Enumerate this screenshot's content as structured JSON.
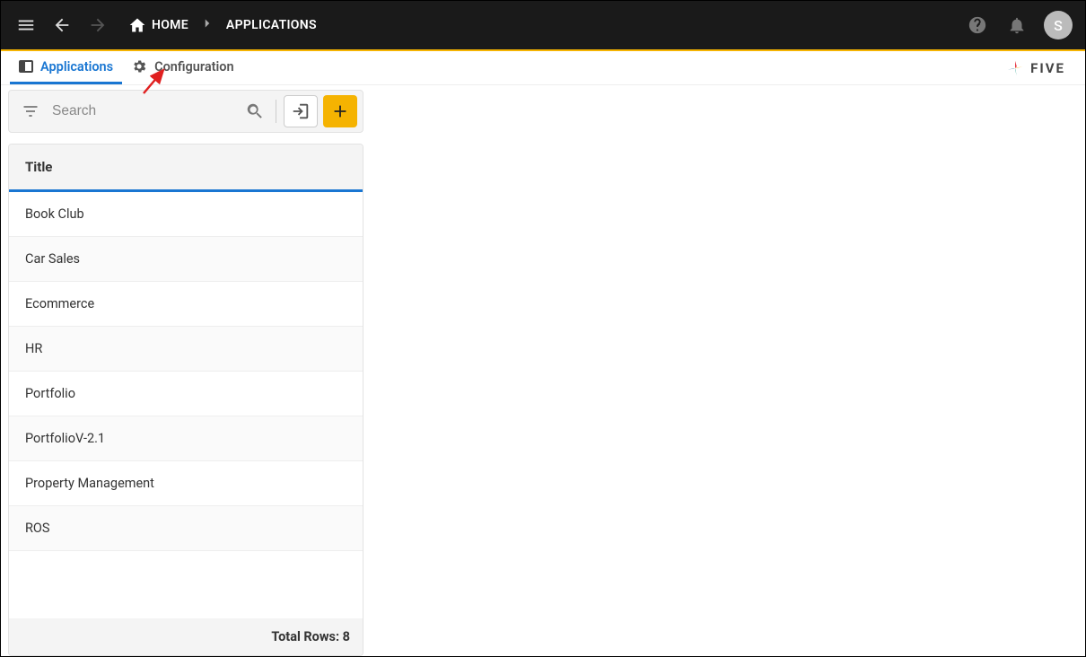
{
  "header": {
    "home_label": "HOME",
    "current_page": "APPLICATIONS",
    "avatar_initial": "S"
  },
  "tabs": {
    "applications": "Applications",
    "configuration": "Configuration"
  },
  "brand": "FIVE",
  "search": {
    "placeholder": "Search"
  },
  "table": {
    "header": "Title",
    "rows": [
      "Book Club",
      "Car Sales",
      "Ecommerce",
      "HR",
      "Portfolio",
      "PortfolioV-2.1",
      "Property Management",
      "ROS"
    ],
    "footer_label": "Total Rows:",
    "footer_count": "8"
  }
}
